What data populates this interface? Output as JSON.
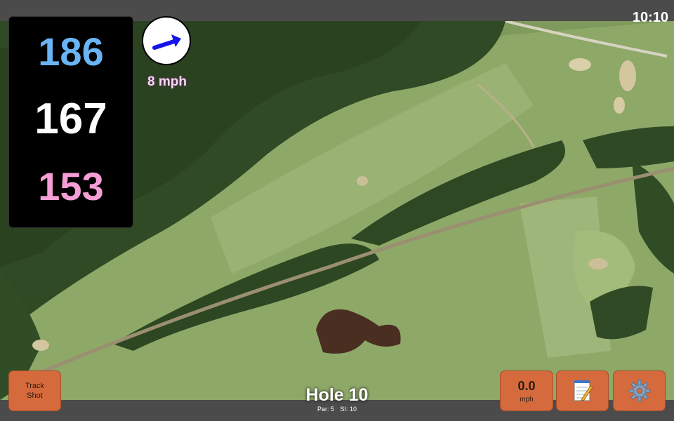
{
  "status_bar": {
    "time": "10:10"
  },
  "distances": {
    "back": "186",
    "middle": "167",
    "front": "153",
    "colors": {
      "back": "#6ab4f5",
      "middle": "#ffffff",
      "front": "#f59ed5"
    }
  },
  "wind": {
    "speed_label": "8 mph",
    "arrow_icon": "wind-direction-arrow-icon"
  },
  "hole": {
    "title": "Hole 10",
    "par_label": "Par: 5",
    "si_label": "SI: 10"
  },
  "buttons": {
    "track_shot": {
      "line1": "Track",
      "line2": "Shot"
    },
    "speed": {
      "value": "0.0",
      "unit": "mph"
    },
    "notes_icon": "notepad-icon",
    "settings_icon": "gear-icon"
  },
  "colors": {
    "button_bg": "#d56a3c",
    "bar_bg": "#4b4b4b"
  }
}
